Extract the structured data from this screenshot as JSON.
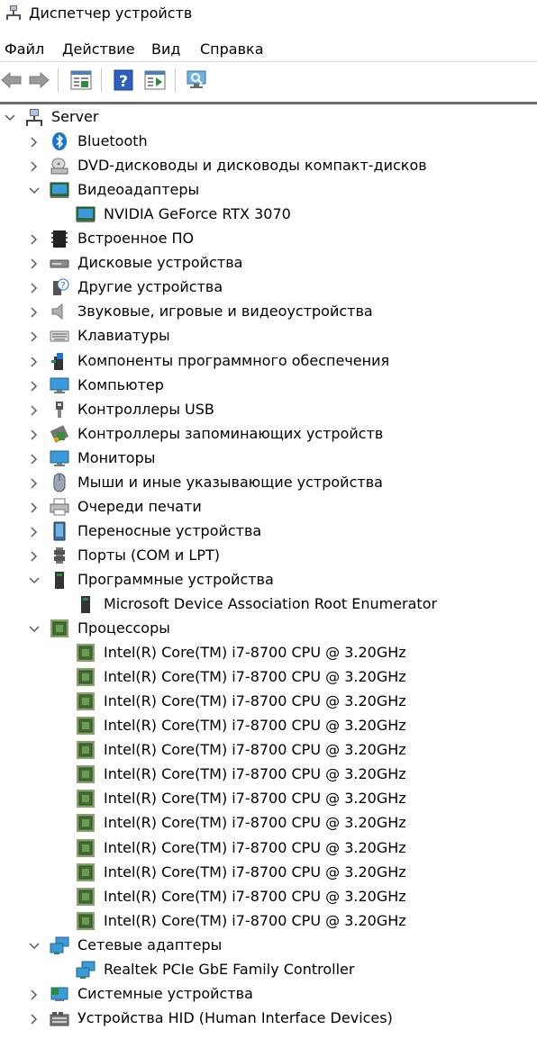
{
  "window": {
    "title": "Диспетчер устройств"
  },
  "menu": [
    "Файл",
    "Действие",
    "Вид",
    "Справка"
  ],
  "toolbar": {
    "buttons": [
      {
        "name": "back-button",
        "icon": "arrow-left-icon"
      },
      {
        "name": "forward-button",
        "icon": "arrow-right-icon"
      },
      {
        "name": "properties-button",
        "icon": "properties-icon"
      },
      {
        "name": "help-button",
        "icon": "help-icon"
      },
      {
        "name": "update-driver-button",
        "icon": "update-icon"
      },
      {
        "name": "scan-hardware-button",
        "icon": "monitor-scan-icon"
      }
    ]
  },
  "tree": {
    "root": {
      "label": "Server",
      "expanded": true,
      "icon": "computer-network-icon"
    },
    "categories": [
      {
        "label": "Bluetooth",
        "icon": "bluetooth-icon",
        "expanded": false,
        "children": []
      },
      {
        "label": "DVD-дисководы и дисководы компакт-дисков",
        "icon": "dvd-drive-icon",
        "expanded": false,
        "children": []
      },
      {
        "label": "Видеоадаптеры",
        "icon": "display-adapter-icon",
        "expanded": true,
        "children": [
          "NVIDIA GeForce RTX 3070"
        ]
      },
      {
        "label": "Встроенное ПО",
        "icon": "firmware-icon",
        "expanded": false,
        "children": []
      },
      {
        "label": "Дисковые устройства",
        "icon": "disk-drive-icon",
        "expanded": false,
        "children": []
      },
      {
        "label": "Другие устройства",
        "icon": "unknown-device-icon",
        "expanded": false,
        "children": []
      },
      {
        "label": "Звуковые, игровые и видеоустройства",
        "icon": "speaker-icon",
        "expanded": false,
        "children": []
      },
      {
        "label": "Клавиатуры",
        "icon": "keyboard-icon",
        "expanded": false,
        "children": []
      },
      {
        "label": "Компоненты программного обеспечения",
        "icon": "software-component-icon",
        "expanded": false,
        "children": []
      },
      {
        "label": "Компьютер",
        "icon": "computer-icon",
        "expanded": false,
        "children": []
      },
      {
        "label": "Контроллеры USB",
        "icon": "usb-icon",
        "expanded": false,
        "children": []
      },
      {
        "label": "Контроллеры запоминающих устройств",
        "icon": "storage-controller-icon",
        "expanded": false,
        "children": []
      },
      {
        "label": "Мониторы",
        "icon": "monitor-icon",
        "expanded": false,
        "children": []
      },
      {
        "label": "Мыши и иные указывающие устройства",
        "icon": "mouse-icon",
        "expanded": false,
        "children": []
      },
      {
        "label": "Очереди печати",
        "icon": "printer-icon",
        "expanded": false,
        "children": []
      },
      {
        "label": "Переносные устройства",
        "icon": "portable-device-icon",
        "expanded": false,
        "children": []
      },
      {
        "label": "Порты (COM и LPT)",
        "icon": "port-icon",
        "expanded": false,
        "children": []
      },
      {
        "label": "Программные устройства",
        "icon": "software-device-icon",
        "expanded": true,
        "children": [
          "Microsoft Device Association Root Enumerator"
        ]
      },
      {
        "label": "Процессоры",
        "icon": "processor-icon",
        "expanded": true,
        "children": [
          "Intel(R) Core(TM) i7-8700 CPU @ 3.20GHz",
          "Intel(R) Core(TM) i7-8700 CPU @ 3.20GHz",
          "Intel(R) Core(TM) i7-8700 CPU @ 3.20GHz",
          "Intel(R) Core(TM) i7-8700 CPU @ 3.20GHz",
          "Intel(R) Core(TM) i7-8700 CPU @ 3.20GHz",
          "Intel(R) Core(TM) i7-8700 CPU @ 3.20GHz",
          "Intel(R) Core(TM) i7-8700 CPU @ 3.20GHz",
          "Intel(R) Core(TM) i7-8700 CPU @ 3.20GHz",
          "Intel(R) Core(TM) i7-8700 CPU @ 3.20GHz",
          "Intel(R) Core(TM) i7-8700 CPU @ 3.20GHz",
          "Intel(R) Core(TM) i7-8700 CPU @ 3.20GHz",
          "Intel(R) Core(TM) i7-8700 CPU @ 3.20GHz"
        ]
      },
      {
        "label": "Сетевые адаптеры",
        "icon": "network-adapter-icon",
        "expanded": true,
        "children": [
          "Realtek PCIe GbE Family Controller"
        ]
      },
      {
        "label": "Системные устройства",
        "icon": "system-device-icon",
        "expanded": false,
        "children": []
      },
      {
        "label": "Устройства HID (Human Interface Devices)",
        "icon": "hid-icon",
        "expanded": false,
        "children": []
      }
    ]
  },
  "colors": {
    "accent": "#2b78d0",
    "chevron": "#5a5a5a",
    "cpu_green": "#3f6f33",
    "separator": "#6d6d6d"
  }
}
